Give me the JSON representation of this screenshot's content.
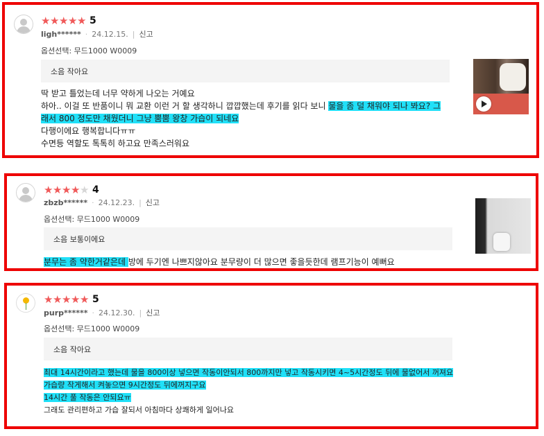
{
  "reviews": [
    {
      "score": "5",
      "user": "ligh******",
      "date": "24.12.15.",
      "report": "신고",
      "option": "옵션선택: 무드1000 W0009",
      "summary": "소음 작아요",
      "lines": {
        "l1": "딱 받고 틀었는데 너무 약하게 나오는 거예요",
        "l2a": "하아.. 이걸 또 반품이니 뭐 교환 이런 거 할 생각하니 깝깝했는데 후기를 읽다 보니 ",
        "l2b": "물을 좀 덜 채워야 되나 봐요? 그",
        "l3": "래서 800 정도만 채웠더니 그냥 뿜뿜 왕창 가습이 되네요",
        "l4": "다행이에요 행복합니다ㅠㅠ",
        "l5": "수면등 역할도 톡톡히 하고요 만족스러워요"
      }
    },
    {
      "score": "4",
      "user": "zbzb******",
      "date": "24.12.23.",
      "report": "신고",
      "option": "옵션선택: 무드1000 W0009",
      "summary": "소음 보통이에요",
      "lines": {
        "l1a": "분무는 좀 약한거같은데 ",
        "l1b": "방에 두기엔 나쁘지않아요 분무량이 더 많으면 좋을듯한데 램프기능이 예뻐요"
      }
    },
    {
      "score": "5",
      "user": "purp******",
      "date": "24.12.30.",
      "report": "신고",
      "option": "옵션선택: 무드1000 W0009",
      "summary": "소음 작아요",
      "lines": {
        "l1": "최대 14시간이라고 했는데 물을 800이상 넣으면 작동이안되서 800까지만 넣고 작동시키면 4~5시간정도 뒤에 물없어서 꺼져요",
        "l2": "가습량 작게해서 켜놓으면 9시간정도 뒤에꺼지구요",
        "l3": "14시간 풀 작동은 안되요ㅠ",
        "l4": "그래도 관리편하고 가습 잘되서 아침마다 상쾌하게 일어나요"
      }
    }
  ],
  "icons": {
    "star": "star-icon",
    "avatar": "avatar-icon",
    "play": "play-icon"
  },
  "colors": {
    "frame": "#ee0000",
    "highlight": "#20e0f8",
    "star": "#f05a5a"
  }
}
